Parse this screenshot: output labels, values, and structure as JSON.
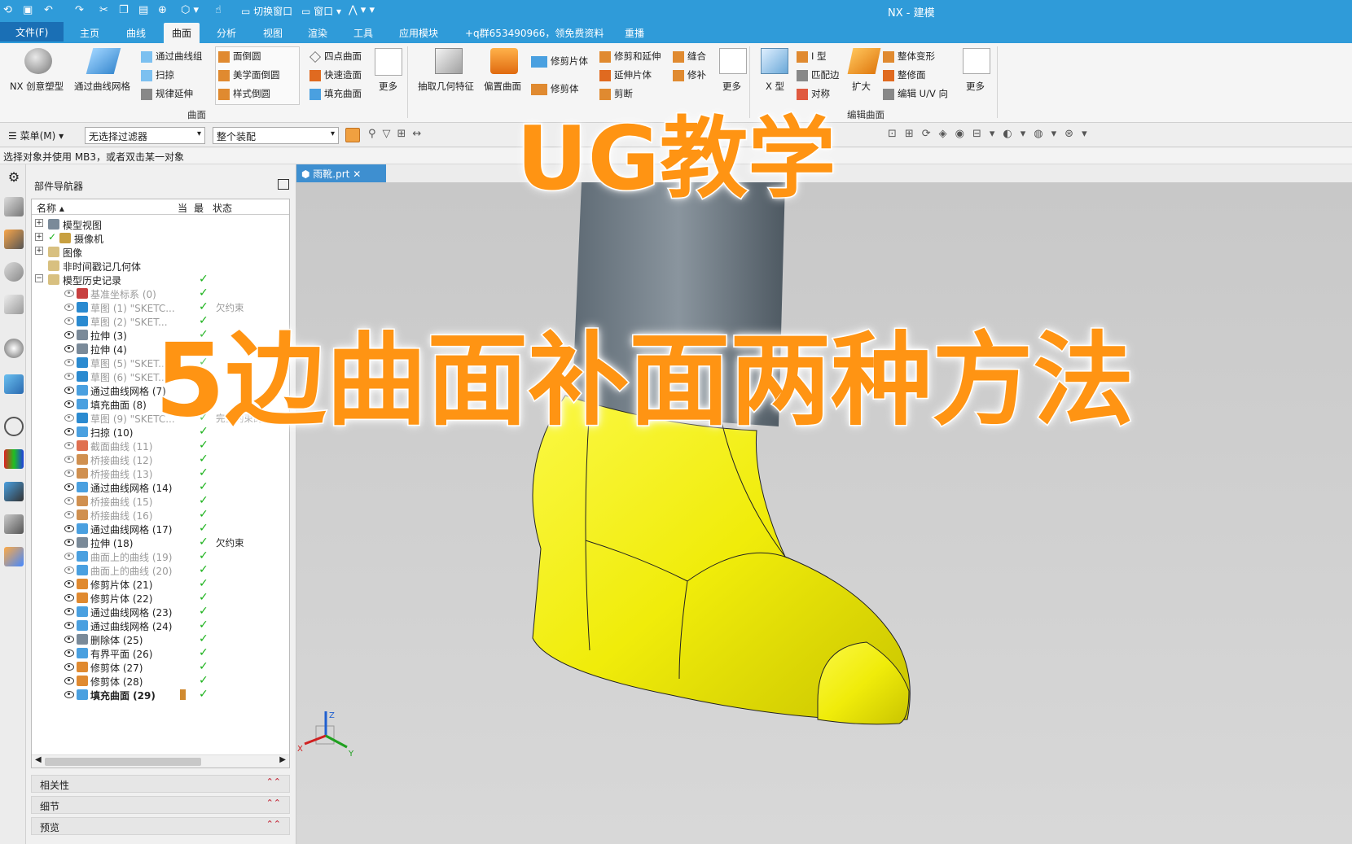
{
  "window": {
    "title": "NX - 建模",
    "quick_access": {
      "switch_window": "切换窗口",
      "window": "窗口"
    }
  },
  "menu": {
    "file": "文件(F)",
    "tabs": [
      "主页",
      "曲线",
      "曲面",
      "分析",
      "视图",
      "渲染",
      "工具",
      "应用模块",
      "+q群653490966，领免费资料",
      "重播"
    ],
    "active_tab": "曲面"
  },
  "ribbon": {
    "nx_creative": "NX 创意塑型",
    "through_curve_mesh": "通过曲线网格",
    "through_curves": "通过曲线组",
    "sweep": "扫掠",
    "ruled_extend": "规律延伸",
    "face_blend": "面倒圆",
    "aesthetic_blend": "美学面倒圆",
    "styled_blend": "样式倒圆",
    "four_point": "四点曲面",
    "quick_surface": "快速造面",
    "fill_surface": "填充曲面",
    "more": "更多",
    "group_surface": "曲面",
    "extract_geometry": "抽取几何特征",
    "offset_surface": "偏置曲面",
    "trim_sheet": "修剪片体",
    "trim_body": "修剪体",
    "trim_extend": "修剪和延伸",
    "extend_sheet": "延伸片体",
    "split": "剪断",
    "sew": "缝合",
    "patch": "修补",
    "x_form": "X 型",
    "i_form": "I 型",
    "match_edge": "匹配边",
    "symmetry": "对称",
    "enlarge": "扩大",
    "global_shape": "整体变形",
    "trim_face": "整修面",
    "edit_uv": "编辑 U/V 向",
    "group_edit": "编辑曲面"
  },
  "cmdbar": {
    "menu": "菜单(M)",
    "filter": "无选择过滤器",
    "assembly": "整个装配"
  },
  "cue": "选择对象并使用 MB3，或者双击某一对象",
  "navigator": {
    "title": "部件导航器",
    "columns": {
      "name": "名称",
      "current": "当",
      "latest": "最",
      "status": "状态"
    },
    "top_nodes": [
      "模型视图",
      "摄像机",
      "图像",
      "非时间戳记几何体",
      "模型历史记录"
    ],
    "history": [
      {
        "label": "基准坐标系 (0)",
        "dim": true,
        "status": "",
        "color": "#c84040"
      },
      {
        "label": "草图 (1) \"SKETC...",
        "dim": true,
        "status": "欠约束",
        "color": "#2a8ad0"
      },
      {
        "label": "草图 (2) \"SKET...",
        "dim": true,
        "status": "",
        "color": "#2a8ad0"
      },
      {
        "label": "拉伸 (3)",
        "dim": false,
        "status": "",
        "color": "#7a8a99"
      },
      {
        "label": "拉伸 (4)",
        "dim": false,
        "status": "",
        "color": "#7a8a99"
      },
      {
        "label": "草图 (5) \"SKET...",
        "dim": true,
        "status": "",
        "color": "#2a8ad0"
      },
      {
        "label": "草图 (6) \"SKET...",
        "dim": true,
        "status": "",
        "color": "#2a8ad0"
      },
      {
        "label": "通过曲线网格 (7)",
        "dim": false,
        "status": "",
        "color": "#4aa0e0"
      },
      {
        "label": "填充曲面 (8)",
        "dim": false,
        "status": "",
        "color": "#4aa0e0"
      },
      {
        "label": "草图 (9) \"SKETC...",
        "dim": true,
        "status": "完全约束的",
        "color": "#2a8ad0"
      },
      {
        "label": "扫掠 (10)",
        "dim": false,
        "status": "",
        "color": "#4aa0e0"
      },
      {
        "label": "截面曲线 (11)",
        "dim": true,
        "status": "",
        "color": "#e07050"
      },
      {
        "label": "桥接曲线 (12)",
        "dim": true,
        "status": "",
        "color": "#d09050"
      },
      {
        "label": "桥接曲线 (13)",
        "dim": true,
        "status": "",
        "color": "#d09050"
      },
      {
        "label": "通过曲线网格 (14)",
        "dim": false,
        "status": "",
        "color": "#4aa0e0"
      },
      {
        "label": "桥接曲线 (15)",
        "dim": true,
        "status": "",
        "color": "#d09050"
      },
      {
        "label": "桥接曲线 (16)",
        "dim": true,
        "status": "",
        "color": "#d09050"
      },
      {
        "label": "通过曲线网格 (17)",
        "dim": false,
        "status": "",
        "color": "#4aa0e0"
      },
      {
        "label": "拉伸 (18)",
        "dim": false,
        "status": "欠约束",
        "color": "#7a8a99"
      },
      {
        "label": "曲面上的曲线 (19)",
        "dim": true,
        "status": "",
        "color": "#4aa0e0"
      },
      {
        "label": "曲面上的曲线 (20)",
        "dim": true,
        "status": "",
        "color": "#4aa0e0"
      },
      {
        "label": "修剪片体 (21)",
        "dim": false,
        "status": "",
        "color": "#e08a30"
      },
      {
        "label": "修剪片体 (22)",
        "dim": false,
        "status": "",
        "color": "#e08a30"
      },
      {
        "label": "通过曲线网格 (23)",
        "dim": false,
        "status": "",
        "color": "#4aa0e0"
      },
      {
        "label": "通过曲线网格 (24)",
        "dim": false,
        "status": "",
        "color": "#4aa0e0"
      },
      {
        "label": "删除体 (25)",
        "dim": false,
        "status": "",
        "color": "#7a8a99"
      },
      {
        "label": "有界平面 (26)",
        "dim": false,
        "status": "",
        "color": "#4aa0e0"
      },
      {
        "label": "修剪体 (27)",
        "dim": false,
        "status": "",
        "color": "#e08a30"
      },
      {
        "label": "修剪体 (28)",
        "dim": false,
        "status": "",
        "color": "#e08a30"
      },
      {
        "label": "填充曲面 (29)",
        "dim": false,
        "status": "",
        "color": "#4aa0e0",
        "bold": true
      }
    ],
    "panels": [
      "相关性",
      "细节",
      "预览"
    ]
  },
  "graphics": {
    "tab": "雨靴.prt",
    "axis": {
      "x": "X",
      "y": "Y",
      "z": "Z"
    }
  },
  "overlay": {
    "line1": "UG教学",
    "line2": "5边曲面补面两种方法"
  },
  "colors": {
    "accent": "#2f9bd9",
    "boot": "#f2ee0a",
    "overlay": "#ff9413"
  }
}
